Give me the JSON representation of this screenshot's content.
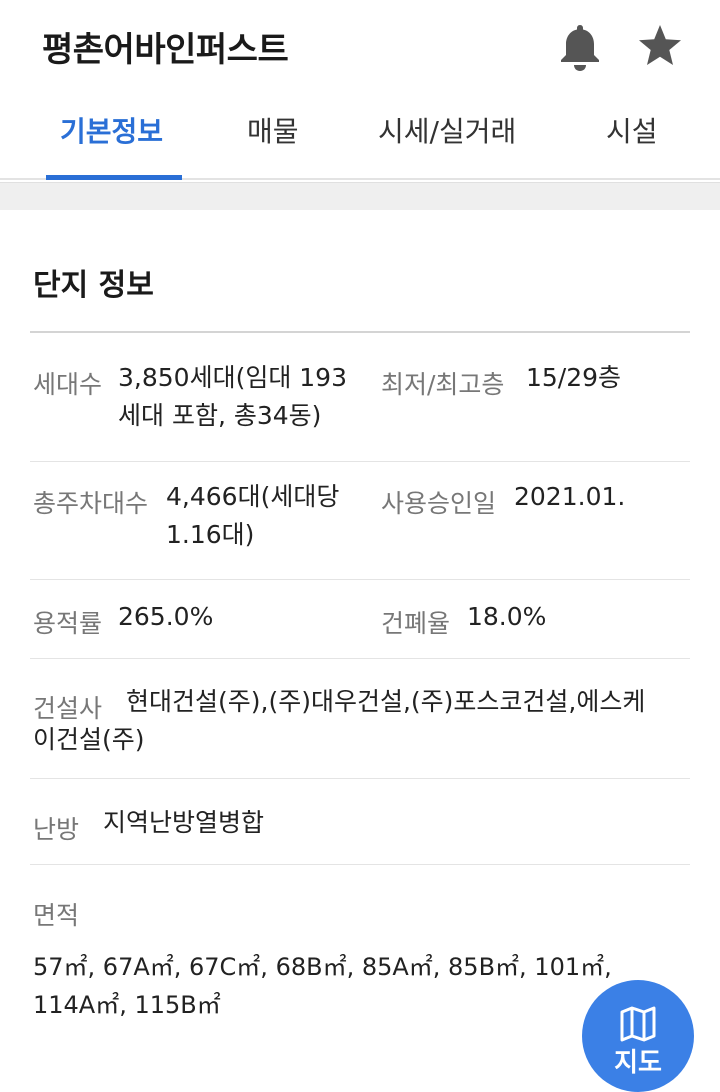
{
  "header": {
    "title": "평촌어바인퍼스트",
    "icons": [
      "bell-icon",
      "star-icon"
    ]
  },
  "tabs": [
    {
      "label": "기본정보",
      "active": true
    },
    {
      "label": "매물",
      "active": false
    },
    {
      "label": "시세/실거래",
      "active": false
    },
    {
      "label": "시설",
      "active": false
    }
  ],
  "colors": {
    "accent": "#2a6fd6",
    "fab": "#3b80e6",
    "icon_gray": "#555555"
  },
  "complex": {
    "section_title": "단지 정보",
    "households": {
      "label": "세대수",
      "value_line1": "3,850세대(임대 193",
      "value_line2": "세대 포함, 총34동)"
    },
    "floors": {
      "label": "최저/최고층",
      "value": "15/29층"
    },
    "parking": {
      "label": "총주차대수",
      "value_line1": "4,466대(세대당",
      "value_line2": "1.16대)"
    },
    "approval": {
      "label": "사용승인일",
      "value": "2021.01."
    },
    "floor_area_ratio": {
      "label": "용적률",
      "value": "265.0%"
    },
    "coverage_ratio": {
      "label": "건폐율",
      "value": "18.0%"
    },
    "builder": {
      "label": "건설사",
      "value_line1": "현대건설(주),(주)대우건설,(주)포스코건설,에스케",
      "value_line2": "이건설(주)"
    },
    "heating": {
      "label": "난방",
      "value": "지역난방열병합"
    },
    "area": {
      "label": "면적",
      "value_line1": "57㎡, 67A㎡, 67C㎡, 68B㎡, 85A㎡, 85B㎡, 101㎡,",
      "value_line2": "114A㎡, 115B㎡"
    }
  },
  "fab": {
    "label": "지도",
    "icon": "map-icon"
  }
}
